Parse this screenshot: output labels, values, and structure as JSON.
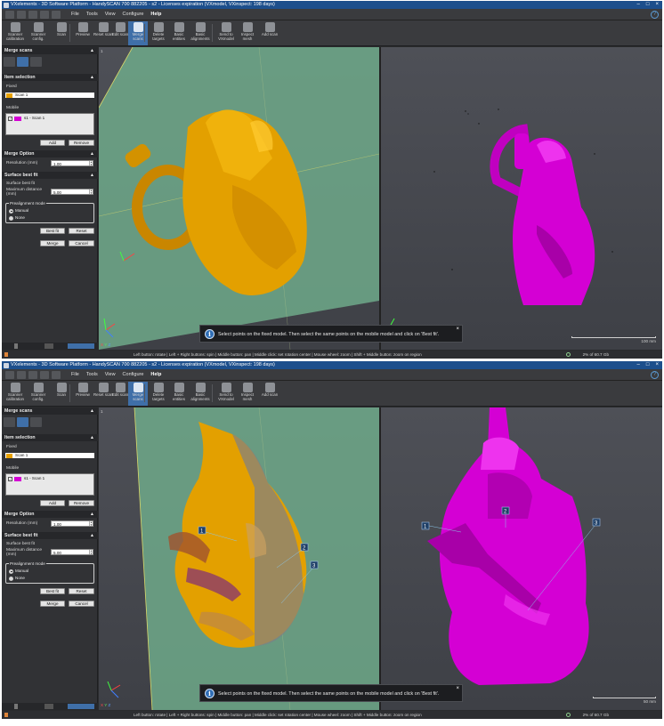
{
  "window": {
    "title": "VXelements - 3D Software Platform - HandySCAN 700 882205 - s2 - Licenses expiration (VXmodel, VXinspect: 198 days)"
  },
  "menu": {
    "items": [
      "File",
      "Tools",
      "View",
      "Configure",
      "Help"
    ],
    "active": "Help"
  },
  "toolbar": {
    "items": [
      {
        "label": "Scanner calibration"
      },
      {
        "label": "Scanner config."
      },
      {
        "label": "Scan"
      },
      {
        "label": "Preview"
      },
      {
        "label": "Reset scan"
      },
      {
        "label": "Edit scan"
      },
      {
        "label": "Merge scans",
        "active": true
      },
      {
        "label": "Delete targets"
      },
      {
        "label": "Basic entities"
      },
      {
        "label": "Basic alignments"
      },
      {
        "label": "Send to VXmodel"
      },
      {
        "label": "Inspect mesh"
      },
      {
        "label": "Add scan"
      }
    ]
  },
  "panel": {
    "merge_header": "Merge scans",
    "item_selection_header": "Item selection",
    "fixed_label": "Fixed",
    "fixed_item": "Scan 1",
    "mobile_label": "Mobile",
    "mobile_item": "s1 - Scan 1",
    "add_label": "Add",
    "remove_label": "Remove",
    "merge_option_header": "Merge Option",
    "resolution_label": "Resolution (mm)",
    "resolution_value": "1.00",
    "best_fit_header": "Surface best fit",
    "best_fit_label": "Surface best fit",
    "max_distance_label": "Maximum distance (mm)",
    "max_distance_value": "5.00",
    "prealign_label": "Prealignment mode",
    "manual_label": "Manual",
    "none_label": "None",
    "best_fit_button": "Best fit",
    "reset_button": "Reset",
    "merge_button": "Merge",
    "cancel_button": "Cancel"
  },
  "viewport": {
    "message": "Select points on the fixed model. Then select the same points on the mobile model and click on 'Best fit'.",
    "close_glyph": "×",
    "info_glyph": "i",
    "axis_x": "X",
    "axis_y": "Y",
    "axis_z": "Z",
    "corner_label": "1"
  },
  "screens": [
    {
      "scale_label": "100 mm",
      "memory": "2% of 60.7 Gb"
    },
    {
      "scale_label": "50 mm",
      "memory": "2% of 60.7 Gb",
      "point_labels": [
        "1",
        "2",
        "3"
      ]
    }
  ],
  "statusbar": {
    "hint": "Left button: rotate | Left + Right buttons: spin | Middle button: pan | Middle click: set rotation center | Mouse wheel: zoom | Shift + Middle button: zoom on region"
  },
  "colors": {
    "fixed_scan": "#e8a100",
    "mobile_scan": "#d400d4",
    "ground_plane": "#6fa98a",
    "accent": "#3f6fa8"
  }
}
